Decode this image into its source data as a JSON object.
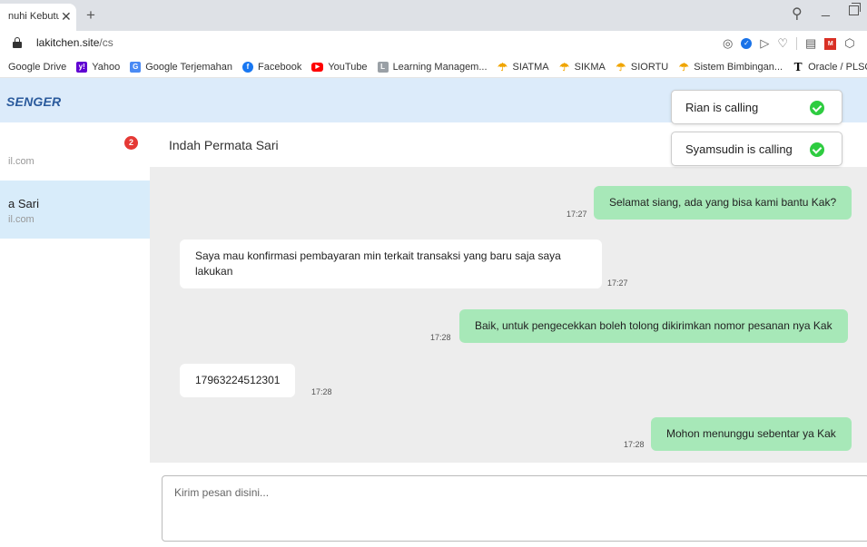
{
  "browser": {
    "tab_title": "nuhi Kebutu",
    "tab_close": "✕",
    "new_tab": "+",
    "url_domain": "lakitchen.site",
    "url_path": "/cs"
  },
  "bookmarks": [
    {
      "label": "Google Drive",
      "icon": "google-drive-icon"
    },
    {
      "label": "Yahoo",
      "icon": "yahoo-icon",
      "glyph": "y!"
    },
    {
      "label": "Google Terjemahan",
      "icon": "translate-icon",
      "glyph": "G"
    },
    {
      "label": "Facebook",
      "icon": "facebook-icon",
      "glyph": "f"
    },
    {
      "label": "YouTube",
      "icon": "youtube-icon",
      "glyph": "▶"
    },
    {
      "label": "Learning Managem...",
      "icon": "learning-icon",
      "glyph": "L"
    },
    {
      "label": "SIATMA",
      "icon": "umbrella-icon",
      "glyph": "☂"
    },
    {
      "label": "SIKMA",
      "icon": "umbrella-icon",
      "glyph": "☂"
    },
    {
      "label": "SIORTU",
      "icon": "umbrella-icon",
      "glyph": "☂"
    },
    {
      "label": "Sistem Bimbingan...",
      "icon": "umbrella-icon",
      "glyph": "☂"
    },
    {
      "label": "Oracle / PLSQL",
      "icon": "oracle-icon",
      "glyph": "T"
    }
  ],
  "app": {
    "brand": "SENGER"
  },
  "conversations": [
    {
      "name": "",
      "email": "il.com",
      "badge": "2"
    },
    {
      "name": "a Sari",
      "email": "il.com"
    }
  ],
  "chat": {
    "title": "Indah Permata Sari",
    "messages": [
      {
        "dir": "out",
        "text": "Selamat siang, ada yang bisa kami bantu Kak?",
        "time": "17:27"
      },
      {
        "dir": "in",
        "text": "Saya mau konfirmasi pembayaran min terkait transaksi yang baru saja saya lakukan",
        "time": "17:27"
      },
      {
        "dir": "out",
        "text": "Baik, untuk pengecekkan boleh tolong dikirimkan nomor pesanan nya Kak",
        "time": "17:28"
      },
      {
        "dir": "in",
        "text": "17963224512301",
        "time": "17:28"
      },
      {
        "dir": "out",
        "text": "Mohon menunggu sebentar ya Kak",
        "time": "17:28"
      }
    ],
    "input_placeholder": "Kirim pesan disini..."
  },
  "toasts": [
    {
      "text": "Rian is calling"
    },
    {
      "text": "Syamsudin is calling"
    }
  ],
  "colors": {
    "header_bg": "#dcebfa",
    "selected_conv_bg": "#d8ecfa",
    "outgoing_bubble": "#a7e8b8",
    "badge": "#e53935",
    "success": "#2ecc40"
  }
}
